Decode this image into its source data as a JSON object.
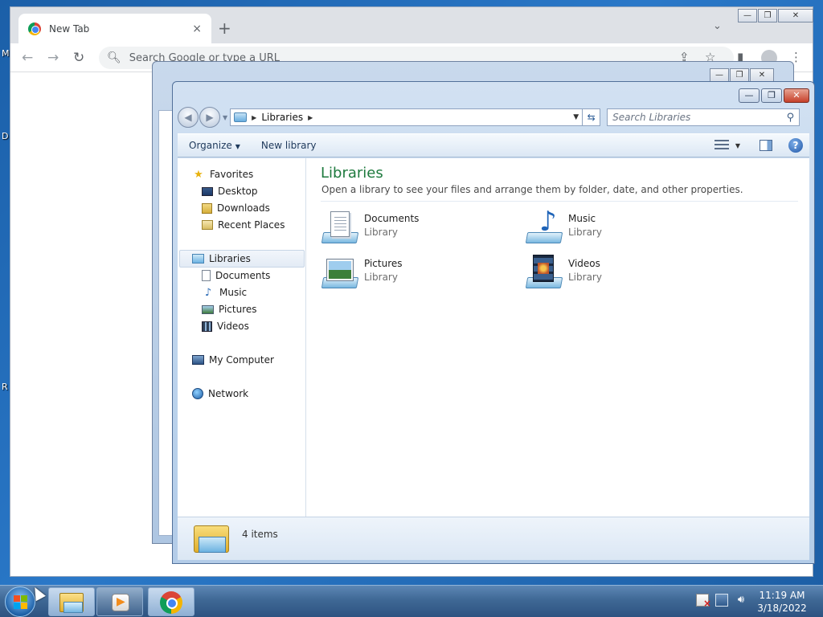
{
  "desktop": {
    "edge_labels": [
      "M",
      "D",
      "R"
    ]
  },
  "chrome": {
    "tab_title": "New Tab",
    "tab_close": "×",
    "new_tab": "+",
    "tabstrip_menu": "⌄",
    "omnibox_placeholder": "Search Google or type a URL",
    "back": "←",
    "forward": "→",
    "reload": "↻",
    "share": "⇪",
    "bookmark": "☆",
    "sidepanel": "▮",
    "menu": "⋮",
    "caps": {
      "min": "—",
      "max": "❐",
      "close": "✕"
    }
  },
  "bg_window": {
    "caps": {
      "min": "—",
      "max": "❐",
      "close": "✕"
    }
  },
  "explorer": {
    "caps": {
      "min": "—",
      "max": "❐",
      "close": "✕"
    },
    "address": {
      "crumb": "Libraries"
    },
    "search_placeholder": "Search Libraries",
    "commands": {
      "organize": "Organize",
      "new_library": "New library"
    },
    "nav_pane": {
      "favorites": "Favorites",
      "favorites_items": [
        "Desktop",
        "Downloads",
        "Recent Places"
      ],
      "libraries": "Libraries",
      "libraries_items": [
        "Documents",
        "Music",
        "Pictures",
        "Videos"
      ],
      "computer": "My Computer",
      "network": "Network"
    },
    "content": {
      "title": "Libraries",
      "subtitle": "Open a library to see your files and arrange them by folder, date, and other properties.",
      "libraries": [
        {
          "name": "Documents",
          "type": "Library"
        },
        {
          "name": "Music",
          "type": "Library"
        },
        {
          "name": "Pictures",
          "type": "Library"
        },
        {
          "name": "Videos",
          "type": "Library"
        }
      ]
    },
    "details": {
      "count": "4 items"
    }
  },
  "taskbar": {
    "time": "11:19 AM",
    "date": "3/18/2022"
  },
  "colors": {
    "library_title": "#1e7a3e",
    "taskbar": "#3f6895",
    "chrome_tabstrip": "#dee1e6"
  }
}
